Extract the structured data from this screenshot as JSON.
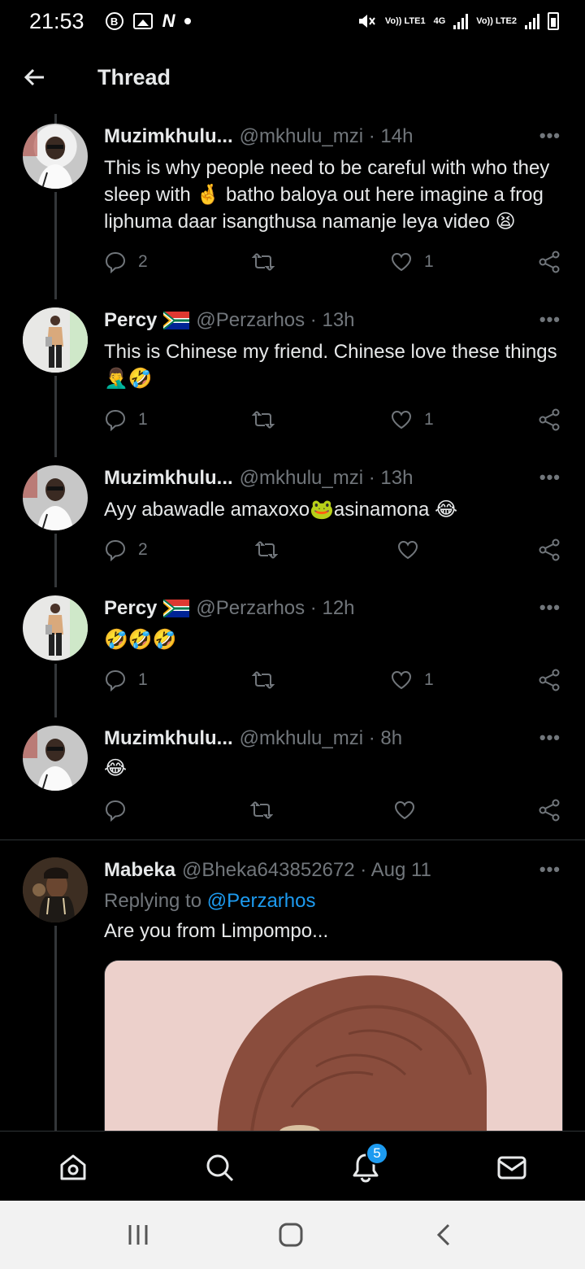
{
  "status_bar": {
    "time": "21:53",
    "icons": [
      "b-icon",
      "gallery-icon",
      "n-icon",
      "dot-icon"
    ],
    "right_tags": [
      "Vo)) LTE1",
      "4G",
      "Vo)) LTE2"
    ]
  },
  "header": {
    "title": "Thread"
  },
  "tweets": [
    {
      "name": "Muzimkhulu...",
      "handle": "@mkhulu_mzi · 14h",
      "text": "This is why people need to be careful with who they sleep with 🤞 batho baloya out here imagine a frog liphuma daar isangthusa namanje leya video 😫",
      "replies": "2",
      "retweets": "",
      "likes": "1"
    },
    {
      "name": "Percy",
      "handle": "@Perzarhos · 13h",
      "text": "This is Chinese my friend. Chinese love these things 🤦‍♂️🤣",
      "replies": "1",
      "retweets": "",
      "likes": "1"
    },
    {
      "name": "Muzimkhulu...",
      "handle": "@mkhulu_mzi · 13h",
      "text": "Ayy abawadle amaxoxo🐸asinamona 😂",
      "replies": "2",
      "retweets": "",
      "likes": ""
    },
    {
      "name": "Percy",
      "handle": "@Perzarhos · 12h",
      "text": "🤣🤣🤣",
      "replies": "1",
      "retweets": "",
      "likes": "1"
    },
    {
      "name": "Muzimkhulu...",
      "handle": "@mkhulu_mzi · 8h",
      "text": "😂",
      "replies": "",
      "retweets": "",
      "likes": ""
    },
    {
      "name": "Mabeka",
      "handle": "@Bheka643852672 · Aug 11",
      "reply_prefix": "Replying to",
      "reply_target": "@Perzarhos",
      "text": "Are you from Limpompo..."
    }
  ],
  "bottom_nav": {
    "items": [
      "home-icon",
      "search-icon",
      "notifications-icon",
      "messages-icon"
    ],
    "notification_count": "5"
  },
  "colors": {
    "background": "#000000",
    "accent": "#1d9bf0",
    "muted": "#71767b"
  }
}
